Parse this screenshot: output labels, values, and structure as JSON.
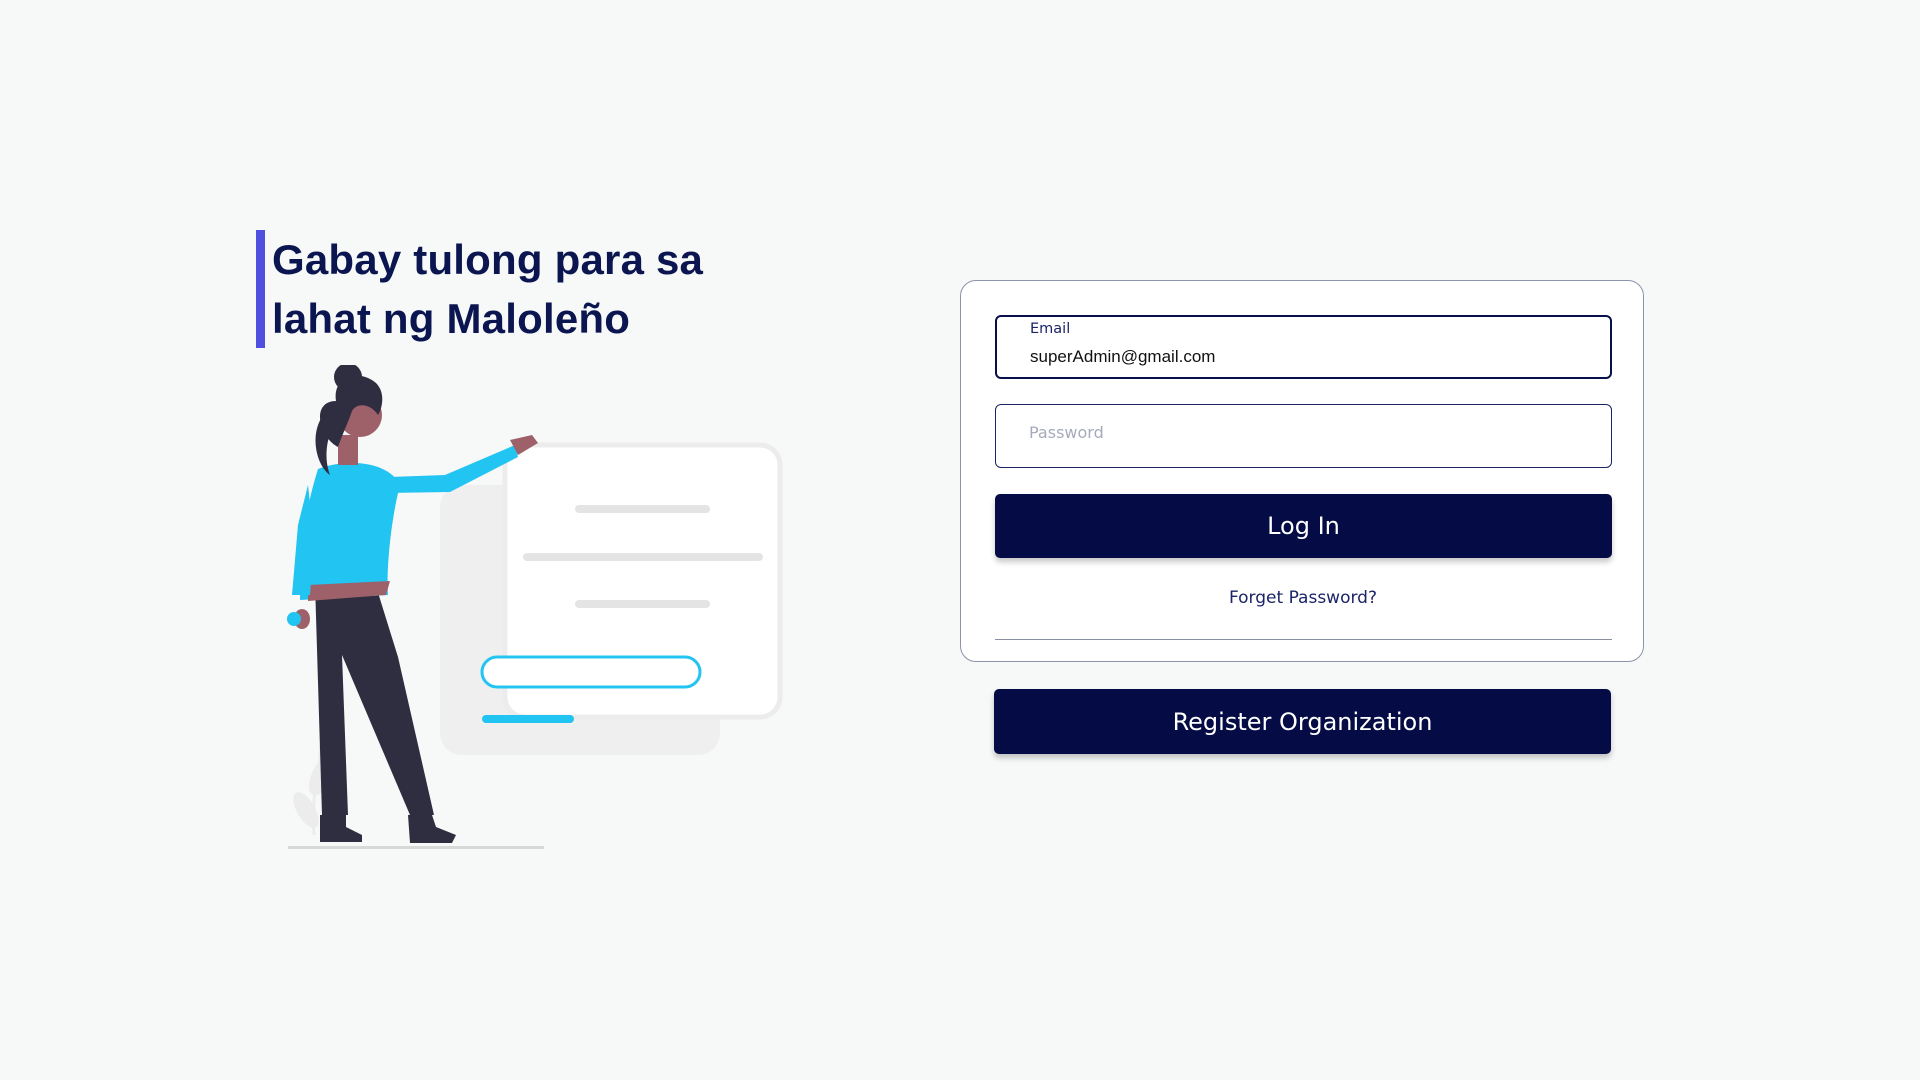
{
  "hero": {
    "title_line1": "Gabay tulong para sa",
    "title_line2": "lahat ng Maloleño"
  },
  "login": {
    "email": {
      "label": "Email",
      "value": "superAdmin@gmail.com"
    },
    "password": {
      "placeholder": "Password"
    },
    "login_button": "Log In",
    "forgot_password": "Forget Password?"
  },
  "register_button": "Register Organization",
  "colors": {
    "brand_navy": "#040b45",
    "heading": "#0b1550",
    "accent_bar": "#4f4fe0",
    "illustration_cyan": "#22c4f2",
    "background": "#f7f8f8"
  },
  "icons": {
    "illustration": "woman-pointing-at-form-illustration"
  }
}
